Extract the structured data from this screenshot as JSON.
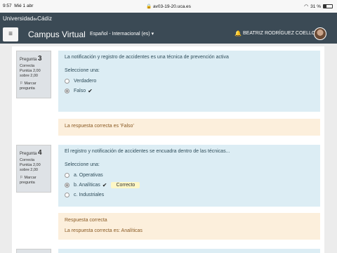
{
  "status": {
    "time": "9:57",
    "date": "Mié 1 abr",
    "url": "av03-19-20.uca.es",
    "battery": "31 %"
  },
  "brand": {
    "main": "Universidad",
    "de": "de",
    "city": "Cádiz"
  },
  "nav": {
    "menu_icon": "hamburger-icon",
    "title": "Campus Virtual",
    "language": "Español - Internacional (es)",
    "user": "BEATRIZ RODRÍGUEZ COELLO"
  },
  "questions": [
    {
      "label": "Pregunta",
      "number": "3",
      "state": "Correcta",
      "score": "Puntúa 2,00 sobre 2,00",
      "flag": "Marcar pregunta",
      "text": "La notificación y registro de accidentes es una técnica de prevención activa",
      "select": "Seleccione una:",
      "options": [
        "Verdadero",
        "Falso"
      ],
      "feedback": [
        "La respuesta correcta es 'Falso'"
      ]
    },
    {
      "label": "Pregunta",
      "number": "4",
      "state": "Correcta",
      "score": "Puntúa 2,00 sobre 2,00",
      "flag": "Marcar pregunta",
      "text": "El registro y notificación de accidentes se encuadra dentro de las técnicas...",
      "select": "Seleccione una:",
      "options": [
        "a. Operativas",
        "b. Analíticas",
        "c. Industriales"
      ],
      "correct_badge": "Correcto",
      "feedback": [
        "Respuesta correcta",
        "La respuesta correcta es: Analíticas"
      ]
    }
  ]
}
